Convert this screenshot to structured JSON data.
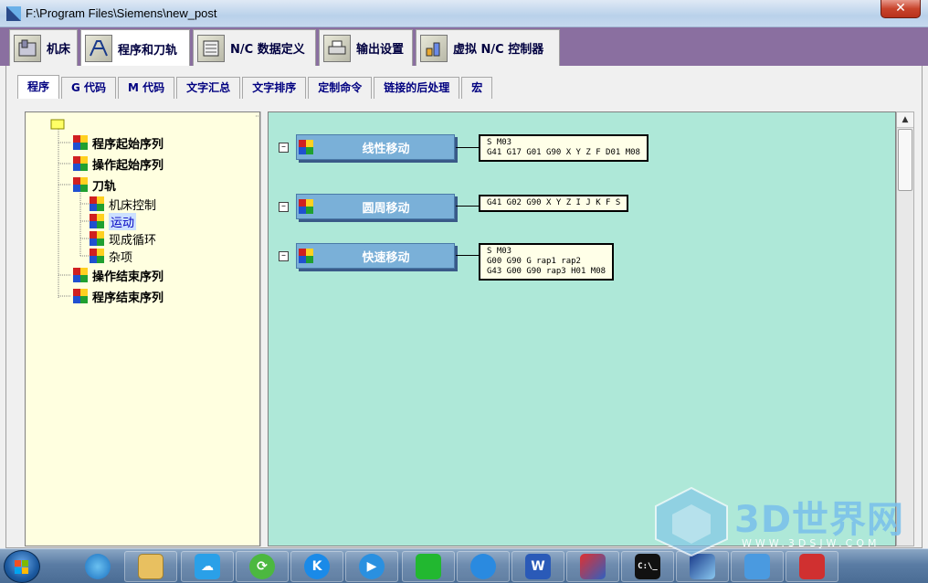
{
  "window": {
    "title": "F:\\Program Files\\Siemens\\new_post",
    "close_label": "✕"
  },
  "main_tabs": [
    {
      "label": "机床",
      "icon": "machine-icon",
      "active": false
    },
    {
      "label": "程序和刀轨",
      "icon": "program-toolpath-icon",
      "active": true
    },
    {
      "label": "N/C 数据定义",
      "icon": "nc-data-icon",
      "active": false
    },
    {
      "label": "输出设置",
      "icon": "printer-icon",
      "active": false
    },
    {
      "label": "虚拟 N/C 控制器",
      "icon": "virtual-controller-icon",
      "active": false
    }
  ],
  "sub_tabs": [
    {
      "label": "程序",
      "active": true
    },
    {
      "label": "G 代码",
      "active": false
    },
    {
      "label": "M 代码",
      "active": false
    },
    {
      "label": "文字汇总",
      "active": false
    },
    {
      "label": "文字排序",
      "active": false
    },
    {
      "label": "定制命令",
      "active": false
    },
    {
      "label": "链接的后处理",
      "active": false
    },
    {
      "label": "宏",
      "active": false
    }
  ],
  "tree": {
    "items": [
      {
        "label": "程序起始序列",
        "level": 1,
        "bold": true,
        "selected": false
      },
      {
        "label": "操作起始序列",
        "level": 1,
        "bold": true,
        "selected": false
      },
      {
        "label": "刀轨",
        "level": 1,
        "bold": true,
        "selected": false
      },
      {
        "label": "机床控制",
        "level": 2,
        "bold": false,
        "selected": false
      },
      {
        "label": "运动",
        "level": 2,
        "bold": false,
        "selected": true
      },
      {
        "label": "现成循环",
        "level": 2,
        "bold": false,
        "selected": false
      },
      {
        "label": "杂项",
        "level": 2,
        "bold": false,
        "selected": false
      },
      {
        "label": "操作结束序列",
        "level": 1,
        "bold": true,
        "selected": false
      },
      {
        "label": "程序结束序列",
        "level": 1,
        "bold": true,
        "selected": false
      }
    ]
  },
  "blocks": [
    {
      "label": "线性移动",
      "code": "S M03\nG41 G17 G01 G90 X Y Z F D01 M08"
    },
    {
      "label": "圆周移动",
      "code": "G41 G02 G90 X Y Z I J K F S"
    },
    {
      "label": "快速移动",
      "code": "S M03\nG00 G90 G rap1 rap2\nG43 G00 G90 rap3 H01 M08"
    }
  ],
  "scrollbar": {
    "up": "▲",
    "down": "▼"
  },
  "taskbar": {
    "items": [
      "qq-icon",
      "file-explorer-icon",
      "cloud-icon",
      "browser-icon",
      "kugou-icon",
      "video-player-icon",
      "iqiyi-icon",
      "baidu-cloud-icon",
      "word-icon",
      "nx-icon",
      "cmd-icon",
      "postbuilder-icon",
      "app-icon",
      "app2-icon"
    ],
    "word_label": "W",
    "cmd_label": "C:\\_",
    "k_label": "K"
  },
  "watermark": {
    "brand": "3D世界网",
    "site": "WWW.3DSJW.COM"
  }
}
